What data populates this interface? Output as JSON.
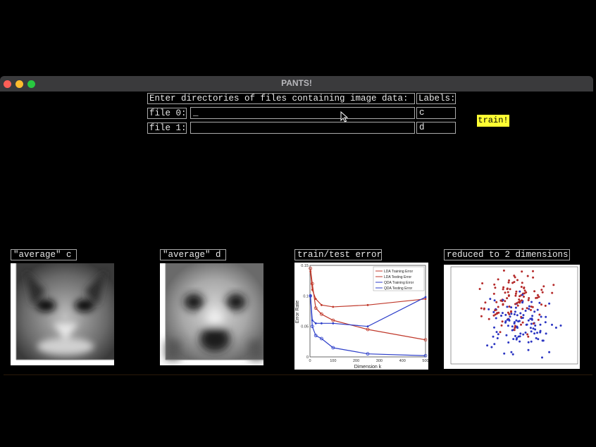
{
  "window": {
    "title": "PANTS!"
  },
  "form": {
    "header": "Enter directories of files containing image data:",
    "labels_header": "Labels:",
    "file0_label": "file 0:",
    "file0_value": "_",
    "file0_tag": "c",
    "file1_label": "file 1:",
    "file1_value": "",
    "file1_tag": "d",
    "train_label": "train!"
  },
  "panels": {
    "avg_c": "\"average\" c",
    "avg_d": "\"average\" d",
    "error": "train/test error",
    "reduced": "reduced to 2 dimensions"
  },
  "chart_data": {
    "type": "line",
    "xlabel": "Dimension k",
    "ylabel": "Error Rate",
    "xlim": [
      0,
      300
    ],
    "ylim": [
      0,
      0.15
    ],
    "x": [
      2,
      10,
      25,
      50,
      100,
      250,
      500
    ],
    "xticks": [
      "0",
      "100",
      "200",
      "300",
      "400",
      "500"
    ],
    "yticks": [
      "0",
      "0.05",
      "0.1",
      "0.15"
    ],
    "series": [
      {
        "name": "LDA Training Error",
        "color": "#c0392b",
        "marker": "circle",
        "values": [
          0.145,
          0.12,
          0.08,
          0.07,
          0.06,
          0.045,
          0.028
        ]
      },
      {
        "name": "LDA Testing Error",
        "color": "#c0392b",
        "marker": "dot",
        "values": [
          0.14,
          0.11,
          0.095,
          0.085,
          0.082,
          0.085,
          0.095
        ]
      },
      {
        "name": "QDA Training Error",
        "color": "#2c3ec9",
        "marker": "circle",
        "values": [
          0.1,
          0.05,
          0.035,
          0.03,
          0.015,
          0.005,
          0.002
        ]
      },
      {
        "name": "QDA Testing Error",
        "color": "#2c3ec9",
        "marker": "dot",
        "values": [
          0.1,
          0.06,
          0.055,
          0.055,
          0.055,
          0.05,
          0.098
        ]
      }
    ],
    "legend": "top-right"
  }
}
